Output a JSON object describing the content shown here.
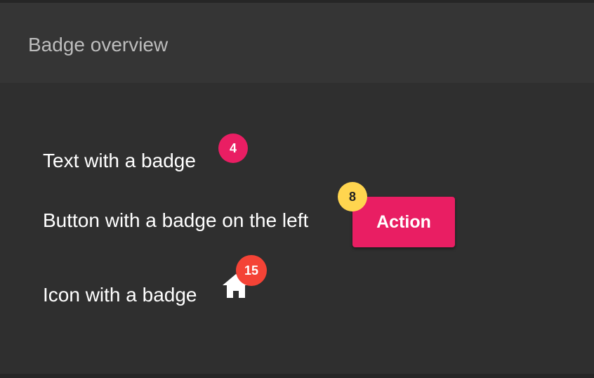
{
  "header": {
    "title": "Badge overview"
  },
  "rows": {
    "text_badge": {
      "label": "Text with a badge",
      "badge": "4"
    },
    "button_badge": {
      "label": "Button with a badge on the left",
      "badge": "8",
      "button_label": "Action"
    },
    "icon_badge": {
      "label": "Icon with a badge",
      "badge": "15",
      "icon": "home-icon"
    }
  },
  "colors": {
    "accent": "#e91e63",
    "badge_yellow": "#ffd54f",
    "badge_red": "#f44336",
    "background": "#2f2f2f",
    "header_background": "#353535"
  }
}
